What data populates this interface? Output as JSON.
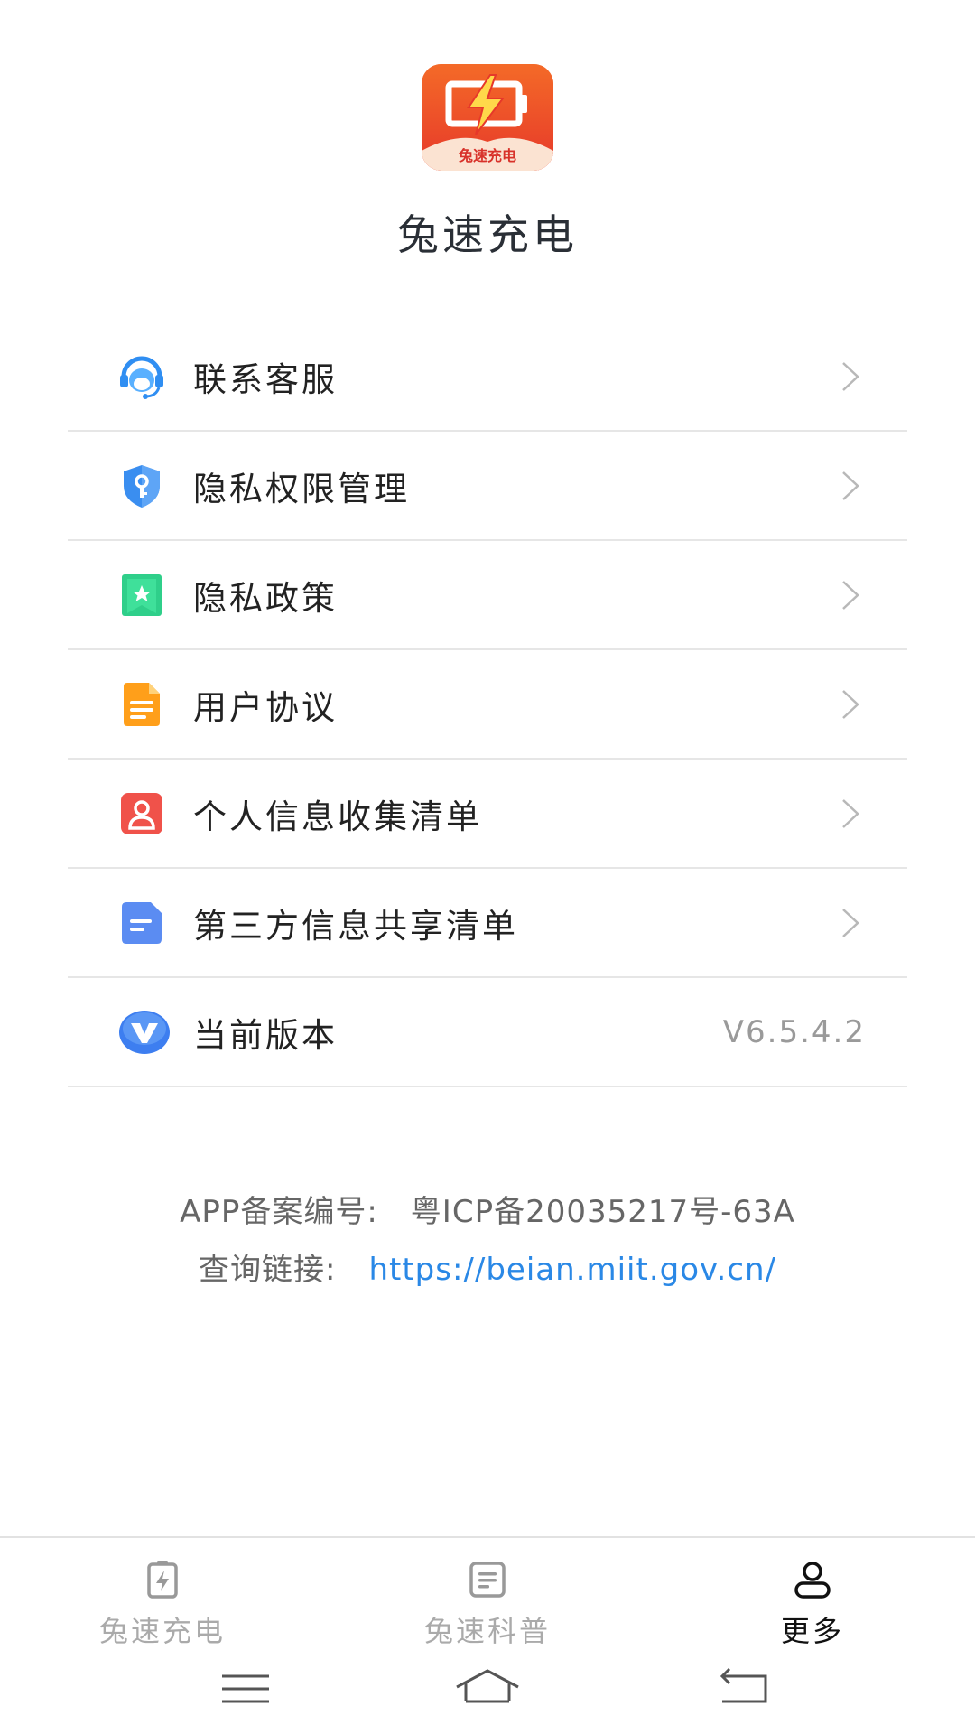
{
  "app": {
    "name": "兔速充电",
    "logo_text": "兔速充电"
  },
  "menu": {
    "items": [
      {
        "label": "联系客服",
        "icon": "customer-service-icon",
        "color": "#2f8ef2"
      },
      {
        "label": "隐私权限管理",
        "icon": "privacy-shield-icon",
        "color": "#3a8ef0"
      },
      {
        "label": "隐私政策",
        "icon": "bookmark-star-icon",
        "color": "#2fcf8a"
      },
      {
        "label": "用户协议",
        "icon": "document-icon",
        "color": "#ff9f1a"
      },
      {
        "label": "个人信息收集清单",
        "icon": "person-card-icon",
        "color": "#f0524a"
      },
      {
        "label": "第三方信息共享清单",
        "icon": "notes-icon",
        "color": "#5b8cf2"
      }
    ],
    "version": {
      "label": "当前版本",
      "value": "V6.5.4.2",
      "icon": "version-v-icon",
      "color": "#3d7ef0"
    }
  },
  "record": {
    "label": "APP备案编号:",
    "number": "粤ICP备20035217号-63A",
    "query_label": "查询链接:",
    "query_link": "https://beian.miit.gov.cn/"
  },
  "tabs": [
    {
      "label": "兔速充电",
      "icon": "battery-charge-icon",
      "active": false
    },
    {
      "label": "兔速科普",
      "icon": "article-icon",
      "active": false
    },
    {
      "label": "更多",
      "icon": "person-icon",
      "active": true
    }
  ],
  "navbar": {
    "buttons": [
      "menu-icon",
      "home-icon",
      "back-icon"
    ]
  },
  "colors": {
    "accent_link": "#2a88e6",
    "logo_orange": "#f26a2a",
    "divider": "#e6e6e6"
  }
}
